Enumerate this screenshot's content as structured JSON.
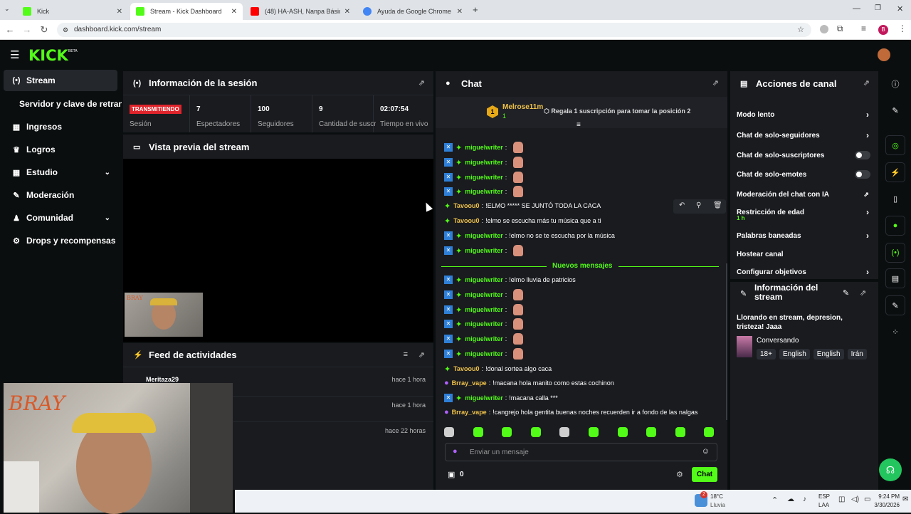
{
  "browser": {
    "tabs": [
      {
        "label": "Kick",
        "color": "#53fc18"
      },
      {
        "label": "Stream - Kick Dashboard",
        "color": "#53fc18"
      },
      {
        "label": "(48) HA-ASH, Nanpa Básico - Tú",
        "color": "#ff0000"
      },
      {
        "label": "Ayuda de Google Chrome",
        "color": "#4285f4"
      }
    ],
    "url": "dashboard.kick.com/stream",
    "profile_initial": "B"
  },
  "app": {
    "logo": "KICK",
    "beta": "BETA"
  },
  "nav": {
    "items": [
      {
        "label": "Stream",
        "icon": "stream-icon",
        "glyph": "(•)",
        "active": true
      },
      {
        "label": "Servidor y clave de retransmisión",
        "icon": "",
        "glyph": ""
      },
      {
        "label": "Ingresos",
        "icon": "income-icon",
        "glyph": "▦"
      },
      {
        "label": "Logros",
        "icon": "trophy-icon",
        "glyph": "🏆"
      },
      {
        "label": "Estudio",
        "icon": "studio-icon",
        "glyph": "▦",
        "chevron": true
      },
      {
        "label": "Moderación",
        "icon": "wrench-icon",
        "glyph": "🔧"
      },
      {
        "label": "Comunidad",
        "icon": "community-icon",
        "glyph": "👥",
        "chevron": true
      },
      {
        "label": "Drops y recompensas",
        "icon": "drops-icon",
        "glyph": "⚙"
      }
    ]
  },
  "session": {
    "title": "Información de la sesión",
    "status": "TRANSMITIENDO",
    "status_label": "Sesión",
    "cells": [
      {
        "value": "7",
        "label": "Espectadores"
      },
      {
        "value": "100",
        "label": "Seguidores"
      },
      {
        "value": "9",
        "label": "Cantidad de suscripciones"
      },
      {
        "value": "02:07:54",
        "label": "Tiempo en vivo"
      }
    ]
  },
  "preview": {
    "title": "Vista previa del stream",
    "cam_text": "BRAY"
  },
  "feed": {
    "title": "Feed de actividades",
    "rows": [
      {
        "name": "Meritaza29",
        "time": "hace 1 hora"
      },
      {
        "name": "",
        "time": "hace 1 hora"
      },
      {
        "name": "",
        "time": "hace 22 horas"
      }
    ]
  },
  "chat": {
    "title": "Chat",
    "pinned": {
      "rank": "1",
      "user": "Melrose11m",
      "count": "1",
      "cta": "Regala 1 suscripción para tomar la posición 2"
    },
    "new_messages_label": "Nuevos mensajes",
    "messages": [
      {
        "user": "miguelwriter",
        "color": "#53fc18",
        "text": "",
        "emote": true,
        "badge": true,
        "sub": "green"
      },
      {
        "user": "miguelwriter",
        "color": "#53fc18",
        "text": "",
        "emote": true,
        "badge": true,
        "sub": "green"
      },
      {
        "user": "miguelwriter",
        "color": "#53fc18",
        "text": "",
        "emote": true,
        "badge": true,
        "sub": "green"
      },
      {
        "user": "miguelwriter",
        "color": "#53fc18",
        "text": "",
        "emote": true,
        "badge": true,
        "sub": "green"
      },
      {
        "user": "Tavoou0",
        "color": "#f0c24b",
        "text": "!ELMO ***** SE JUNTÓ TODA LA CACA",
        "emote": false,
        "badge": false,
        "sub": "green"
      },
      {
        "user": "Tavoou0",
        "color": "#f0c24b",
        "text": "!elmo se escucha más tu música que a ti",
        "emote": false,
        "badge": false,
        "sub": "green"
      },
      {
        "user": "miguelwriter",
        "color": "#53fc18",
        "text": "!elmo no se te escucha por la música",
        "emote": false,
        "badge": true,
        "sub": "green"
      },
      {
        "user": "miguelwriter",
        "color": "#53fc18",
        "text": "",
        "emote": true,
        "badge": true,
        "sub": "green"
      },
      {
        "user": "miguelwriter",
        "color": "#53fc18",
        "text": "!elmo lluvia de patricios",
        "emote": false,
        "badge": true,
        "sub": "green"
      },
      {
        "user": "miguelwriter",
        "color": "#53fc18",
        "text": "",
        "emote": true,
        "badge": true,
        "sub": "green"
      },
      {
        "user": "miguelwriter",
        "color": "#53fc18",
        "text": "",
        "emote": true,
        "badge": true,
        "sub": "green"
      },
      {
        "user": "miguelwriter",
        "color": "#53fc18",
        "text": "",
        "emote": true,
        "badge": true,
        "sub": "green"
      },
      {
        "user": "miguelwriter",
        "color": "#53fc18",
        "text": "",
        "emote": true,
        "badge": true,
        "sub": "green"
      },
      {
        "user": "miguelwriter",
        "color": "#53fc18",
        "text": "",
        "emote": true,
        "badge": true,
        "sub": "green"
      },
      {
        "user": "Tavoou0",
        "color": "#f0c24b",
        "text": "!donal sortea algo caca",
        "emote": false,
        "badge": false,
        "sub": "green"
      },
      {
        "user": "Brray_vape",
        "color": "#f0c24b",
        "text": "!macana hola manito como estas cochinon",
        "emote": false,
        "badge": false,
        "sub": "mic"
      },
      {
        "user": "miguelwriter",
        "color": "#53fc18",
        "text": "!macana calla ***",
        "emote": false,
        "badge": true,
        "sub": "green"
      },
      {
        "user": "Brray_vape",
        "color": "#f0c24b",
        "text": "!cangrejo hola gentita buenas noches recuerden ir a fondo de las nalgas",
        "emote": false,
        "badge": false,
        "sub": "mic"
      }
    ],
    "input_placeholder": "Enviar un mensaje",
    "points": "0",
    "send_label": "Chat"
  },
  "actions": {
    "title": "Acciones de canal",
    "items": [
      {
        "label": "Modo lento",
        "type": "arrow"
      },
      {
        "label": "Chat de solo-seguidores",
        "type": "arrow"
      },
      {
        "label": "Chat de solo-suscriptores",
        "type": "toggle"
      },
      {
        "label": "Chat de solo-emotes",
        "type": "toggle"
      },
      {
        "label": "Moderación del chat con IA",
        "type": "external"
      },
      {
        "label": "Restricción de edad",
        "type": "arrow",
        "sub": "1 h"
      },
      {
        "label": "Palabras baneadas",
        "type": "arrow"
      },
      {
        "label": "Hostear canal",
        "type": "none"
      },
      {
        "label": "Configurar objetivos",
        "type": "arrow"
      }
    ]
  },
  "stream_info": {
    "title": "Información del stream",
    "stream_title": "Llorando en stream, depresion, tristeza! Jaaa",
    "category": "Conversando",
    "tags": [
      "18+",
      "English",
      "English",
      "Irán"
    ]
  },
  "taskbar": {
    "temp": "18°C",
    "weather": "Lluvia",
    "weather_badge": "2",
    "lang1": "ESP",
    "lang2": "LAA",
    "time": "9:24 PM",
    "date": "3/30/2026"
  }
}
